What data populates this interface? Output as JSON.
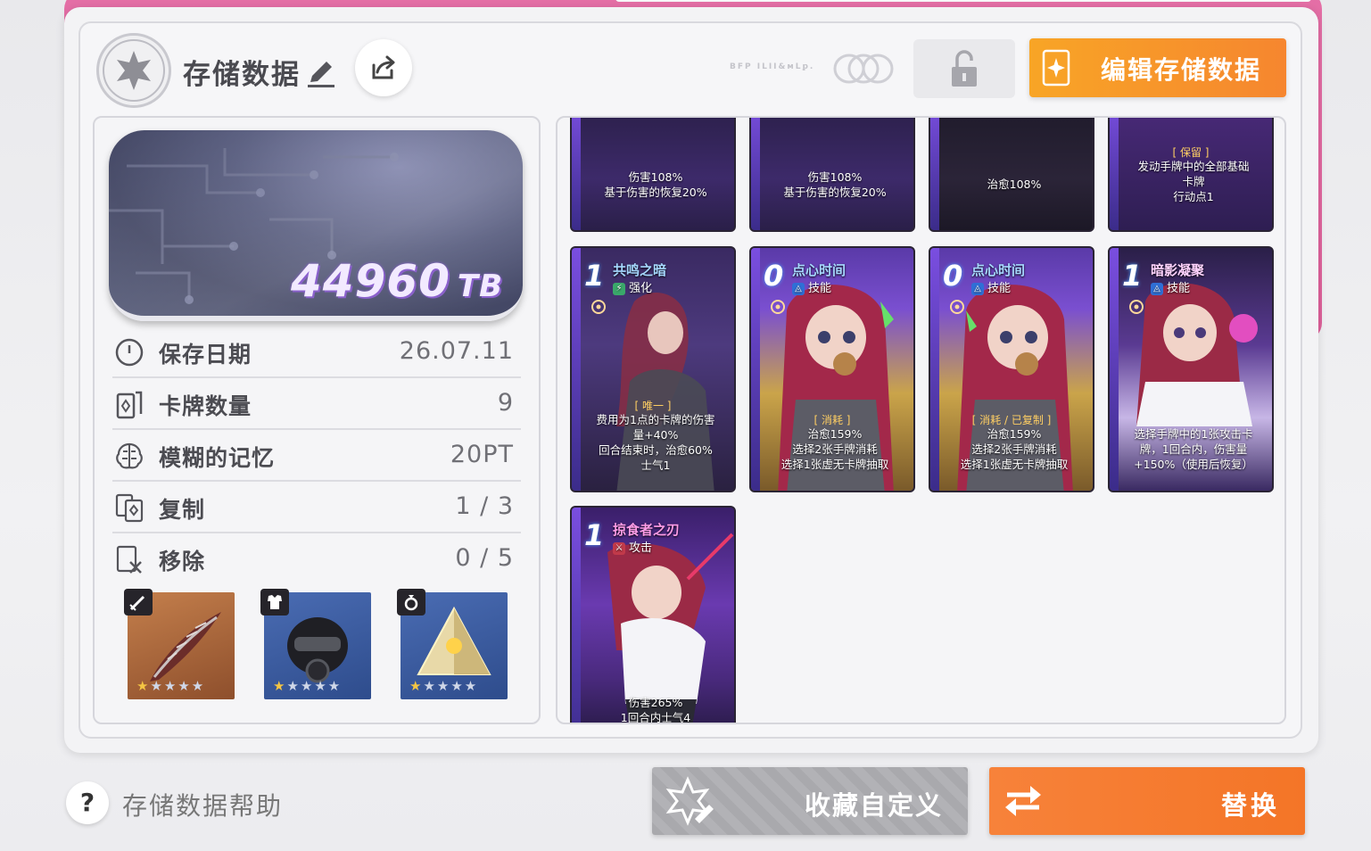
{
  "header": {
    "title": "存储数据",
    "faded_text": "BFP ILII&ᴍLꝑ.",
    "edit_button_label": "编辑存储数据"
  },
  "storage": {
    "value": "44960",
    "unit": "TB"
  },
  "stats": [
    {
      "label": "保存日期",
      "value": "26.07.11",
      "icon": "clock-icon"
    },
    {
      "label": "卡牌数量",
      "value": "9",
      "icon": "card-deck-icon"
    },
    {
      "label": "模糊的记忆",
      "value": "20PT",
      "icon": "brain-icon"
    },
    {
      "label": "复制",
      "value": "1 / 3",
      "icon": "copy-cards-icon"
    },
    {
      "label": "移除",
      "value": "0 / 5",
      "icon": "remove-card-icon"
    }
  ],
  "equipment": [
    {
      "name": "weapon",
      "icon": "sword-icon",
      "stars_filled": 1,
      "stars_total": 5,
      "color": "#b36c3f"
    },
    {
      "name": "armor",
      "icon": "armor-icon",
      "stars_filled": 1,
      "stars_total": 5,
      "color": "#3a5a9e"
    },
    {
      "name": "accessory",
      "icon": "ring-icon",
      "stars_filled": 1,
      "stars_total": 5,
      "color": "#3a5a9e"
    }
  ],
  "cards_top_partial": [
    {
      "desc1": "伤害108%",
      "desc2": "基于伤害的恢复20%"
    },
    {
      "desc1": "伤害108%",
      "desc2": "基于伤害的恢复20%"
    },
    {
      "desc1": "治愈108%",
      "desc2": ""
    },
    {
      "tag": "[ 保留 ]",
      "desc1": "发动手牌中的全部基础",
      "desc2": "卡牌",
      "desc3": "行动点1"
    }
  ],
  "cards": [
    {
      "cost": "1",
      "name": "共鸣之暗",
      "kind": "强化",
      "tag": "[ 唯一 ]",
      "lines": [
        "费用为1点的卡牌的伤害",
        "量+40%",
        "回合结束时，治愈60%",
        "士气1"
      ]
    },
    {
      "cost": "0",
      "name": "点心时间",
      "kind": "技能",
      "tag": "[ 消耗 ]",
      "lines": [
        "治愈159%",
        "选择2张手牌消耗",
        "选择1张虚无卡牌抽取"
      ]
    },
    {
      "cost": "0",
      "name": "点心时间",
      "kind": "技能",
      "tag": "[ 消耗 / 已复制 ]",
      "lines": [
        "治愈159%",
        "选择2张手牌消耗",
        "选择1张虚无卡牌抽取"
      ]
    },
    {
      "cost": "1",
      "name": "暗影凝聚",
      "kind": "技能",
      "tag": "",
      "lines": [
        "选择手牌中的1张攻击卡",
        "牌，1回合内，伤害量",
        "+150%（使用后恢复）"
      ]
    },
    {
      "cost": "1",
      "name": "掠食者之刃",
      "kind": "攻击",
      "tag": "",
      "lines": [
        "伤害265%",
        "1回合内士气4"
      ]
    }
  ],
  "footer": {
    "help_label": "存储数据帮助",
    "help_icon": "?",
    "favorite_label": "收藏自定义",
    "replace_label": "替换"
  },
  "colors": {
    "accent_orange": "#f6862f",
    "frame_pink": "#dd5f99",
    "card_purple": "#5a3aa8"
  }
}
